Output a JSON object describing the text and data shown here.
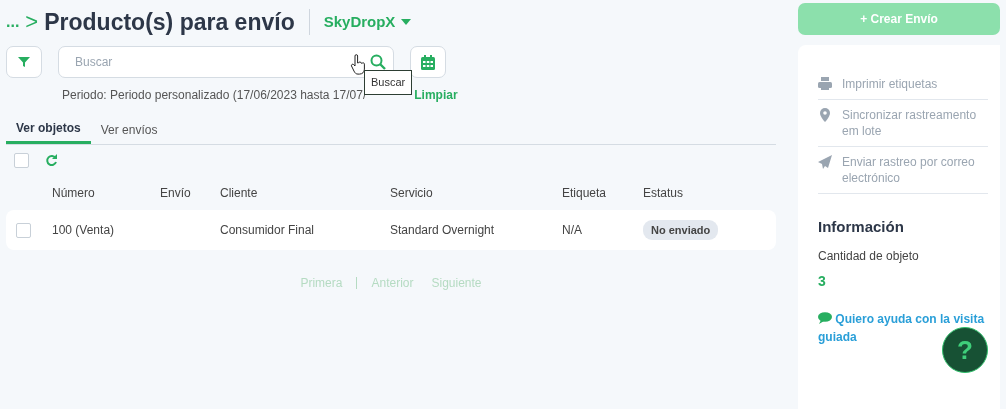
{
  "breadcrumb": {
    "ellipsis": "...",
    "separator": ">",
    "title": "Producto(s) para envío"
  },
  "carrier": {
    "label": "SkyDropX"
  },
  "search": {
    "placeholder": "Buscar",
    "tooltip": "Buscar"
  },
  "period": {
    "text": "Periodo: Periodo personalizado (17/06/2023 hasta 17/07/",
    "clear": "Limpiar"
  },
  "tabs": [
    {
      "label": "Ver objetos",
      "selected": true
    },
    {
      "label": "Ver envíos",
      "selected": false
    }
  ],
  "table": {
    "select_all_checked": false,
    "columns": [
      "Número",
      "Envío",
      "Cliente",
      "Servicio",
      "Etiqueta",
      "Estatus"
    ],
    "rows": [
      {
        "checked": false,
        "cells": [
          "100 (Venta)",
          "",
          "Consumidor Final",
          "Standard Overnight",
          "N/A"
        ],
        "status": "No enviado"
      }
    ]
  },
  "pagination": [
    {
      "label": "Primera",
      "disabled": true
    },
    {
      "label": "Anterior",
      "disabled": true
    },
    {
      "label": "Siguiente",
      "disabled": true
    }
  ],
  "create_button": {
    "label": "+ Crear Envío",
    "disabled": true
  },
  "actions": [
    {
      "kind": "print",
      "label": "Imprimir etiquetas"
    },
    {
      "kind": "pin",
      "label": "Sincronizar rastreamento em lote"
    },
    {
      "kind": "send",
      "label": "Enviar rastreo por correo electrónico"
    }
  ],
  "info": {
    "title": "Información",
    "count_label": "Cantidad de objeto",
    "count": "3",
    "help_link": "Quiero ayuda con la visita guiada"
  },
  "help_button": {
    "label": "?"
  }
}
